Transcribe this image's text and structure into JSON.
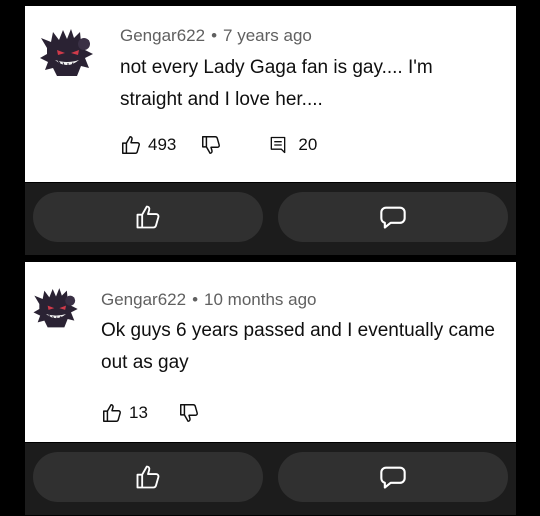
{
  "comments": [
    {
      "author": "Gengar622",
      "separator": "•",
      "time": "7 years ago",
      "text": "not every Lady Gaga fan is gay.... I'm straight and I love her....",
      "likes": "493",
      "replies": "20"
    },
    {
      "author": "Gengar622",
      "separator": "•",
      "time": "10 months ago",
      "text": "Ok guys 6 years passed and I eventually came out as gay",
      "likes": "13"
    }
  ],
  "icons": {
    "like": "thumbs-up-icon",
    "dislike": "thumbs-down-icon",
    "reply": "comment-icon",
    "avatar": "gengar-avatar"
  },
  "colors": {
    "background": "#000000",
    "card": "#ffffff",
    "bar": "#1c1c1c",
    "pill": "#303030",
    "meta_text": "#606060"
  }
}
